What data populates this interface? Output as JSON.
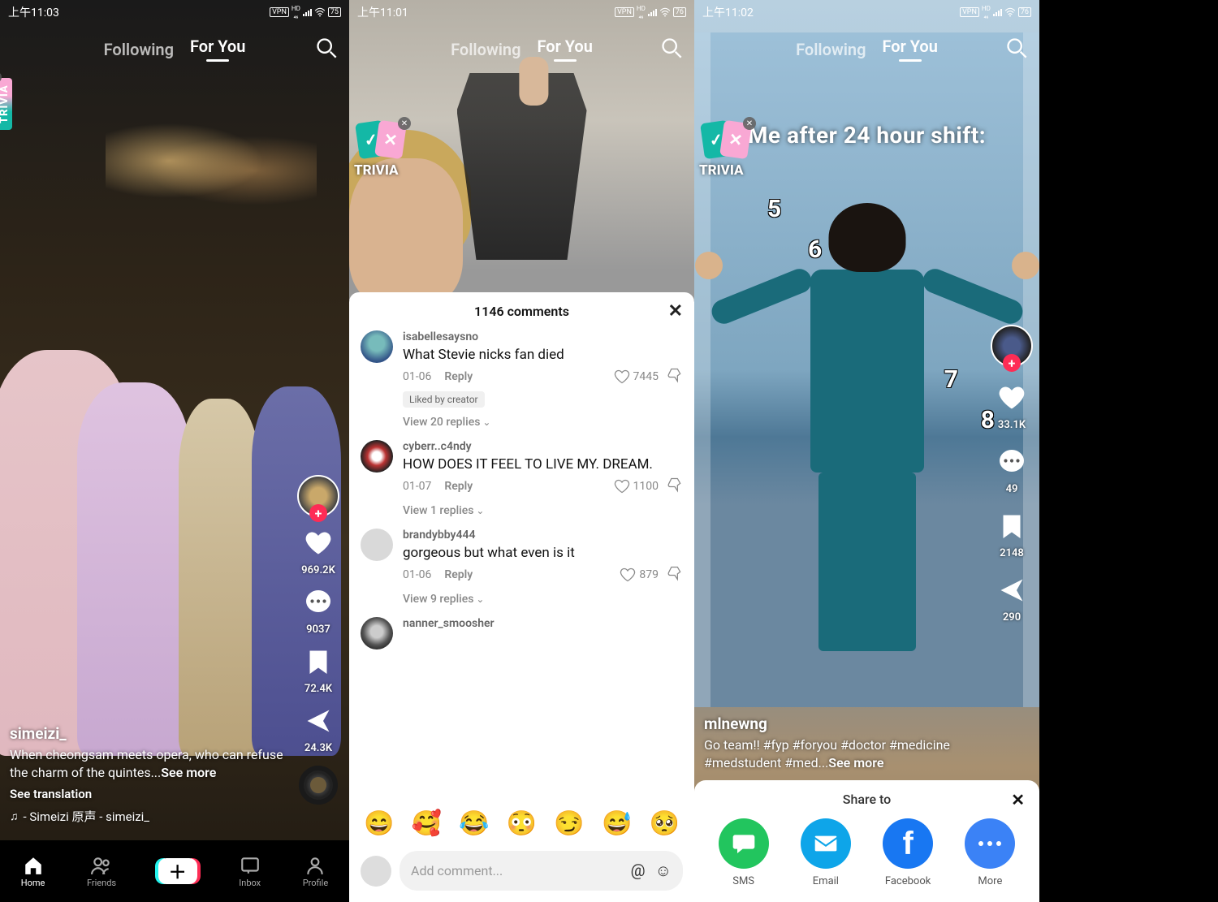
{
  "screens": [
    {
      "status": {
        "time": "上午11:03",
        "vpn": "VPN",
        "hd": "HD",
        "battery": "75"
      },
      "tabs": {
        "following": "Following",
        "foryou": "For You"
      },
      "trivia": "TRIVIA",
      "rail": {
        "like": "969.2K",
        "comment": "9037",
        "save": "72.4K",
        "share": "24.3K"
      },
      "info": {
        "user": "simeizi_",
        "caption": "When cheongsam meets opera, who can refuse the charm of the quintes...",
        "seemore": "See more",
        "translation": "See translation",
        "music": " - Simeizi   原声 - simeizi_"
      },
      "nav": {
        "home": "Home",
        "friends": "Friends",
        "inbox": "Inbox",
        "profile": "Profile"
      }
    },
    {
      "status": {
        "time": "上午11:01",
        "vpn": "VPN",
        "hd": "HD",
        "battery": "76"
      },
      "tabs": {
        "following": "Following",
        "foryou": "For You"
      },
      "trivia": "TRIVIA",
      "sheetTitle": "1146 comments",
      "comments": [
        {
          "name": "isabellesaysno",
          "text": "What Stevie nicks fan died",
          "date": "01-06",
          "reply": "Reply",
          "likes": "7445",
          "badge": "Liked by creator",
          "replies": "View 20 replies"
        },
        {
          "name": "cyberr..c4ndy",
          "text": "HOW DOES IT FEEL TO LIVE MY. DREAM.",
          "date": "01-07",
          "reply": "Reply",
          "likes": "1100",
          "replies": "View 1 replies"
        },
        {
          "name": "brandybby444",
          "text": "gorgeous but what even is it",
          "date": "01-06",
          "reply": "Reply",
          "likes": "879",
          "replies": "View 9 replies"
        },
        {
          "name": "nanner_smoosher"
        }
      ],
      "input": {
        "placeholder": "Add comment..."
      }
    },
    {
      "status": {
        "time": "上午11:02",
        "vpn": "VPN",
        "hd": "HD",
        "battery": "76"
      },
      "tabs": {
        "following": "Following",
        "foryou": "For You"
      },
      "trivia": "TRIVIA",
      "overlayText": "Me after 24 hour shift:",
      "numbers": {
        "n5": "5",
        "n6": "6",
        "n7": "7",
        "n8": "8"
      },
      "rail": {
        "like": "33.1K",
        "comment": "49",
        "save": "2148",
        "share": "290"
      },
      "info": {
        "user": "mlnewng",
        "caption": "Go team!! #fyp #foryou #doctor #medicine #medstudent #med...",
        "seemore": "See more"
      },
      "share": {
        "title": "Share to",
        "sms": "SMS",
        "email": "Email",
        "facebook": "Facebook",
        "more": "More"
      }
    }
  ]
}
